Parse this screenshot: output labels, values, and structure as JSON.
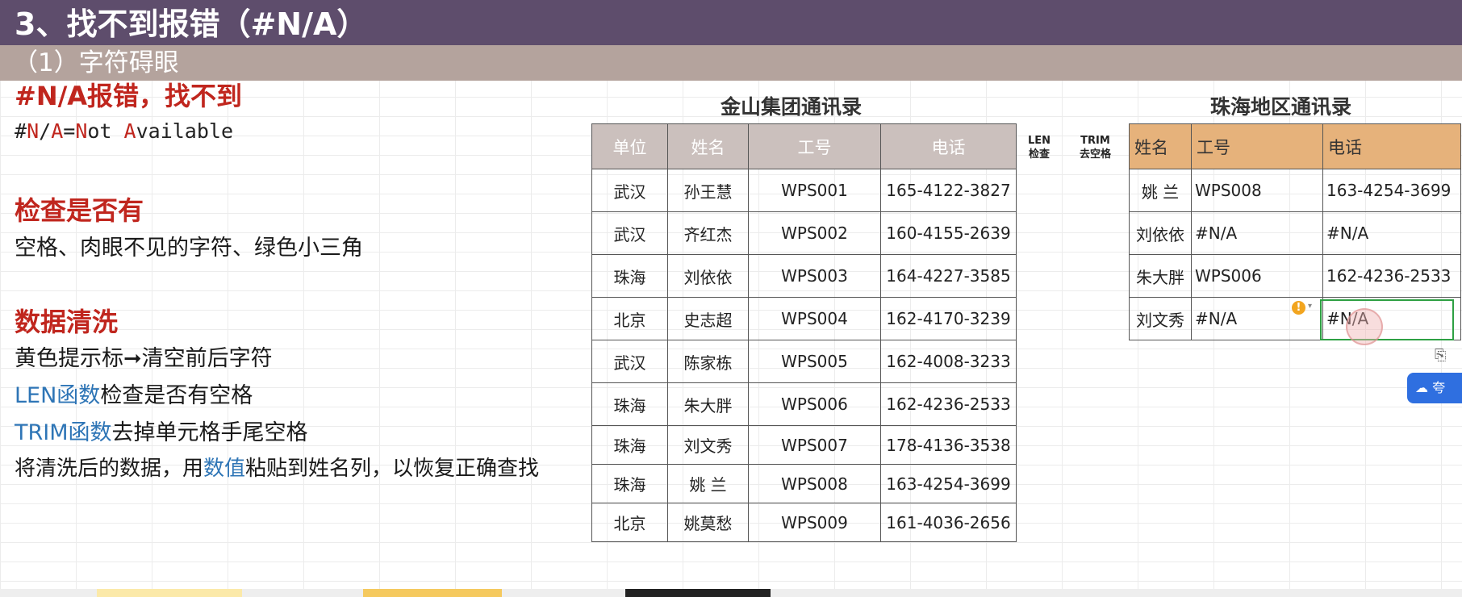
{
  "title": "3、找不到报错（#N/A）",
  "subtitle": "（1）字符碍眼",
  "notes": {
    "heading1": "#N/A报错，找不到",
    "na_prefix": "#",
    "na_n": "N",
    "na_slash": "/",
    "na_a": "A",
    "na_eq": "=",
    "na_not_n": "N",
    "na_not_rest": "ot ",
    "na_avail_a": "A",
    "na_avail_rest": "vailable",
    "heading2": "检查是否有",
    "check_text": "空格、肉眼不见的字符、绿色小三角",
    "heading3": "数据清洗",
    "clean1": "黄色提示标➞清空前后字符",
    "clean2_fn": "LEN函数",
    "clean2_rest": "检查是否有空格",
    "clean3_fn": "TRIM函数",
    "clean3_rest": "去掉单元格手尾空格",
    "clean4_a": "将清洗后的数据，用",
    "clean4_b": "数值",
    "clean4_c": "粘贴到姓名列，以恢复正确查找"
  },
  "table1": {
    "title": "金山集团通讯录",
    "headers": [
      "单位",
      "姓名",
      "工号",
      "电话"
    ],
    "rows": [
      [
        "武汉",
        "孙王慧",
        "WPS001",
        "165-4122-3827"
      ],
      [
        "武汉",
        "齐红杰",
        "WPS002",
        "160-4155-2639"
      ],
      [
        "珠海",
        "刘依依",
        "WPS003",
        "164-4227-3585"
      ],
      [
        "北京",
        "史志超",
        "WPS004",
        "162-4170-3239"
      ],
      [
        "武汉",
        "陈家栋",
        "WPS005",
        "162-4008-3233"
      ],
      [
        "珠海",
        "朱大胖",
        "WPS006",
        "162-4236-2533"
      ],
      [
        "珠海",
        "刘文秀",
        "WPS007",
        "178-4136-3538"
      ],
      [
        "珠海",
        "姚 兰",
        "WPS008",
        "163-4254-3699"
      ],
      [
        "北京",
        "姚莫愁",
        "WPS009",
        "161-4036-2656"
      ]
    ]
  },
  "labels": {
    "len_top": "LEN",
    "len_bottom": "检查",
    "trim_top": "TRIM",
    "trim_bottom": "去空格"
  },
  "table2": {
    "title": "珠海地区通讯录",
    "headers": [
      "姓名",
      "工号",
      "电话"
    ],
    "rows": [
      [
        "姚 兰",
        "WPS008",
        "163-4254-3699"
      ],
      [
        "刘依依",
        "#N/A",
        "#N/A"
      ],
      [
        "朱大胖",
        "WPS006",
        "162-4236-2533"
      ],
      [
        "刘文秀",
        "#N/A",
        "#N/A"
      ]
    ]
  },
  "widgets": {
    "warn_symbol": "!",
    "cloud_label": "☁ 夸"
  },
  "colors": {
    "title_bg": "#5e4d6c",
    "subtitle_bg": "#b4a39d",
    "heading_red": "#c0261e",
    "fn_blue": "#2e75b6",
    "table1_header": "#cbc0bd",
    "table2_header": "#e6b27b"
  }
}
